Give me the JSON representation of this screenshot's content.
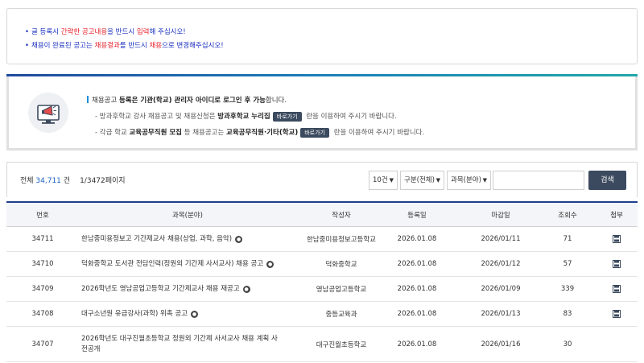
{
  "notice": {
    "line1": {
      "a": "글 등록시 ",
      "b": "간략한 공고내용",
      "c": "을 반드시 ",
      "d": "입력",
      "e": "해 주십시오!"
    },
    "line2": {
      "a": "채용이 완료된 공고는 ",
      "b": "채용결과",
      "c": "를 반드시 ",
      "d": "채용",
      "e": "으로 변경해주십시오!"
    }
  },
  "info": {
    "line1": {
      "a": "채용공고 ",
      "b": "등록은 기관(학교) 관리자 아이디로 로그인 후 가능",
      "c": "합니다."
    },
    "line2": {
      "a": "- 방과후학교 강사 채용공고 및 채용신청은 ",
      "b": "방과후학교 누리집",
      "btn": "바로가기",
      "c": " 란을 이용하여 주시기 바랍니다."
    },
    "line3": {
      "a": "- 각급 학교 ",
      "b": "교육공무직원 모집",
      "c": " 등 채용공고는 ",
      "d": "교육공무직원·기타(학교)",
      "btn": "바로가기",
      "e": " 란을 이용하여 주시기 바랍니다."
    }
  },
  "summary": {
    "total_label": "전체 ",
    "total_count": "34,711",
    "total_unit": " 건",
    "page_info": "1/3472페이지"
  },
  "search": {
    "page_size": "10건",
    "category": "구분(전체)",
    "field": "과목(분야)",
    "query": "",
    "button": "검색"
  },
  "table": {
    "headers": {
      "no": "번호",
      "title": "과목(분야)",
      "writer": "작성자",
      "reg_date": "등록일",
      "deadline": "마감일",
      "views": "조회수",
      "attach": "첨부"
    },
    "rows": [
      {
        "no": "34711",
        "title": "한남중미용정보고 기간제교사 채용(상업, 과학, 음악)",
        "writer": "한남중미용정보고등학교",
        "reg_date": "2026.01.08",
        "deadline": "2026/01/11",
        "views": "71",
        "attach": true
      },
      {
        "no": "34710",
        "title": "덕화중학교 도서관 전담인력(정원외 기간제 사서교사) 채용 공고",
        "writer": "덕화중학교",
        "reg_date": "2026.01.08",
        "deadline": "2026/01/12",
        "views": "57",
        "attach": true
      },
      {
        "no": "34709",
        "title": "2026학년도 영남공업고등학교 기간제교사 채용 재공고",
        "writer": "영남공업고등학교",
        "reg_date": "2026.01.08",
        "deadline": "2026/01/09",
        "views": "339",
        "attach": true
      },
      {
        "no": "34708",
        "title": "대구소년원 유급강사(과학) 위촉 공고",
        "writer": "중등교육과",
        "reg_date": "2026.01.08",
        "deadline": "2026/01/13",
        "views": "83",
        "attach": true
      },
      {
        "no": "34707",
        "title": "2026학년도 대구진월초등학교 정원외 기간제 사서교사 채용 계획 사전공개",
        "writer": "대구진월초등학교",
        "reg_date": "2026.01.08",
        "deadline": "2026/01/16",
        "views": "30",
        "attach": false
      }
    ]
  }
}
